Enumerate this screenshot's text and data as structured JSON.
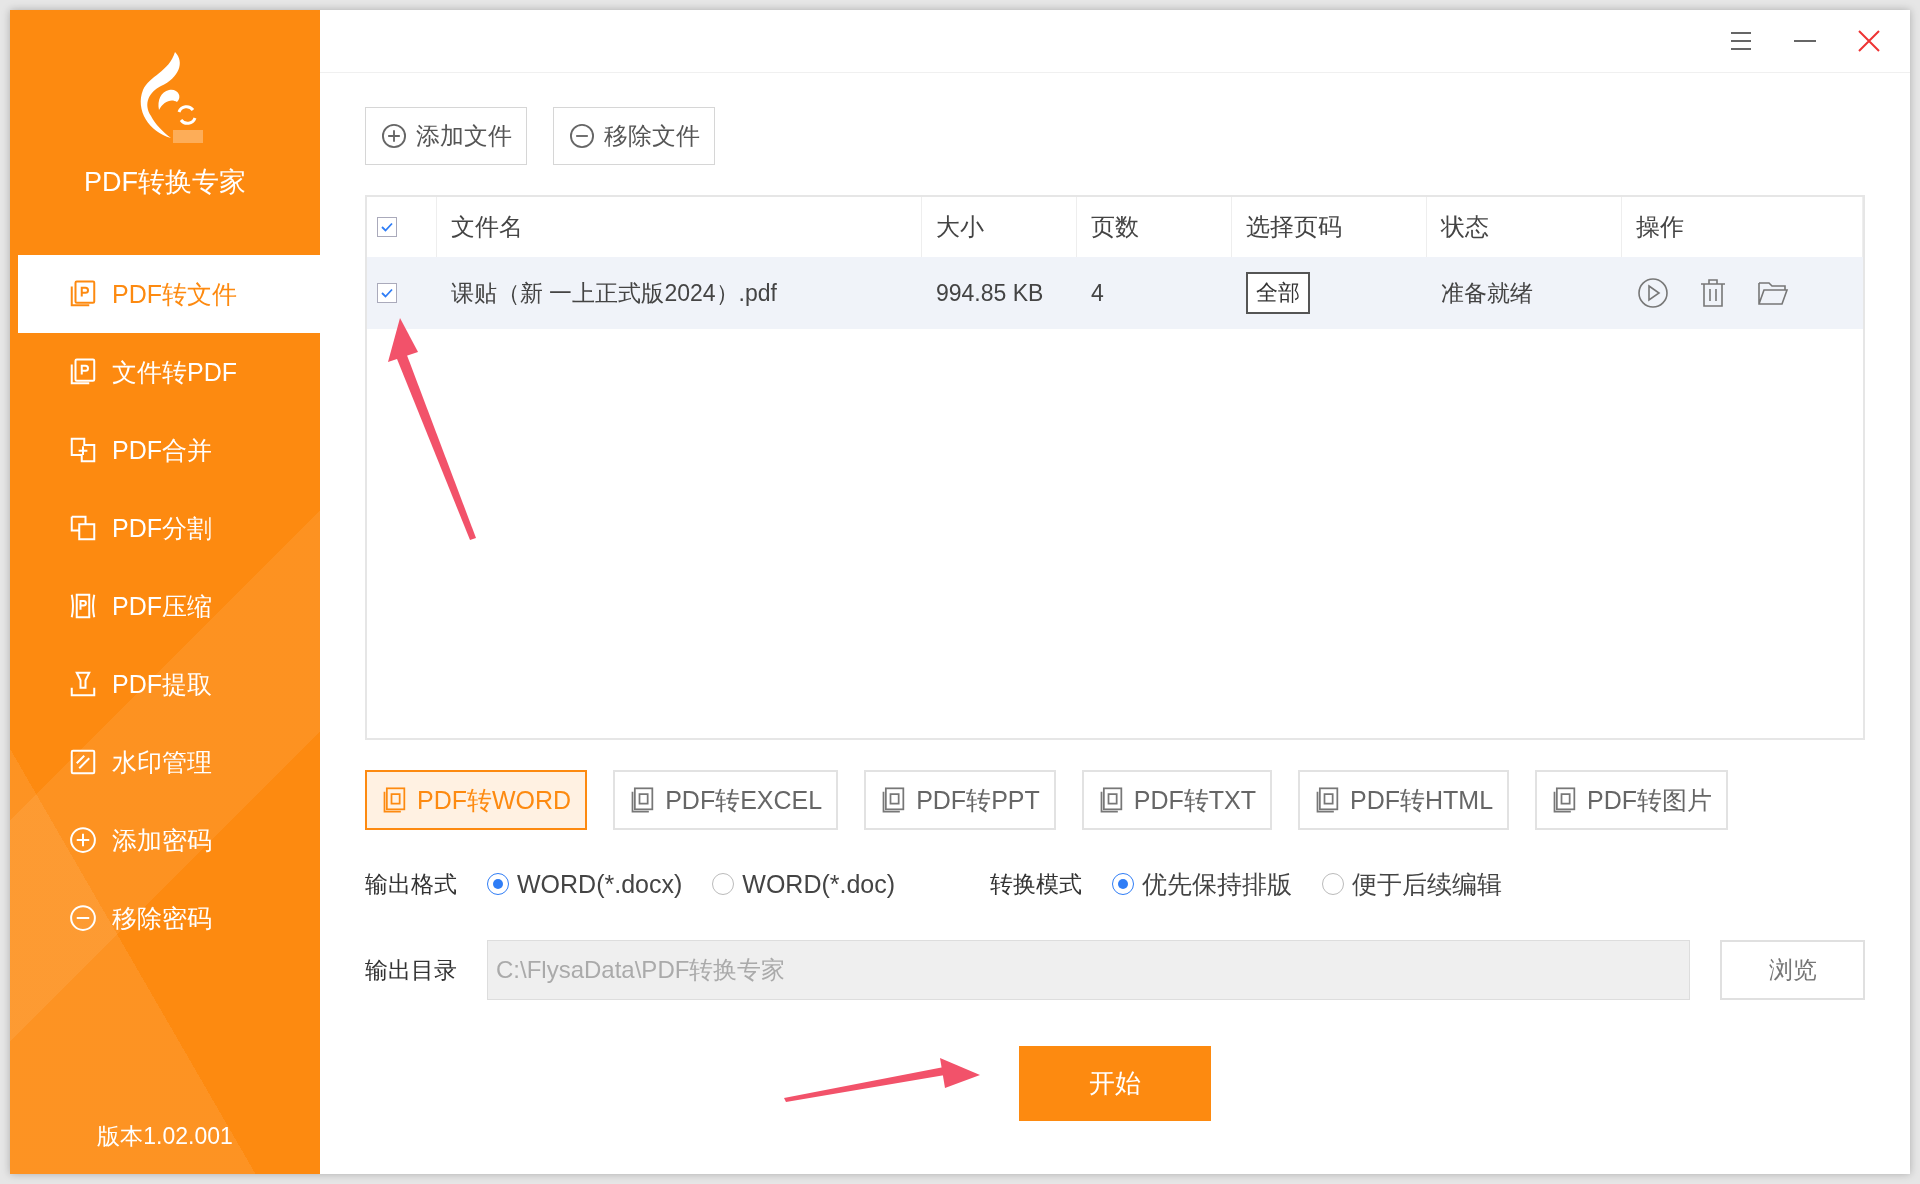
{
  "app": {
    "title": "PDF转换专家",
    "version": "版本1.02.001"
  },
  "sidebar": {
    "items": [
      {
        "label": "PDF转文件",
        "kind": "pdf-to-file",
        "selected": true
      },
      {
        "label": "文件转PDF",
        "kind": "file-to-pdf",
        "selected": false
      },
      {
        "label": "PDF合并",
        "kind": "merge",
        "selected": false
      },
      {
        "label": "PDF分割",
        "kind": "split",
        "selected": false
      },
      {
        "label": "PDF压缩",
        "kind": "compress",
        "selected": false
      },
      {
        "label": "PDF提取",
        "kind": "extract",
        "selected": false
      },
      {
        "label": "水印管理",
        "kind": "watermark",
        "selected": false
      },
      {
        "label": "添加密码",
        "kind": "add",
        "selected": false
      },
      {
        "label": "移除密码",
        "kind": "remove",
        "selected": false
      }
    ]
  },
  "toolbar": {
    "buttons": [
      {
        "label": "添加文件",
        "kind": "add"
      },
      {
        "label": "移除文件",
        "kind": "remove"
      }
    ]
  },
  "table": {
    "all_checked": true,
    "columns": [
      "文件名",
      "大小",
      "页数",
      "选择页码",
      "状态",
      "操作"
    ],
    "rows": [
      {
        "checked": true,
        "name": "课贴（新 一上正式版2024）.pdf",
        "size": "994.85 KB",
        "pages": "4",
        "page_range": "全部",
        "status": "准备就绪"
      }
    ]
  },
  "format_tabs": [
    {
      "label": "PDF转WORD",
      "selected": true
    },
    {
      "label": "PDF转EXCEL",
      "selected": false
    },
    {
      "label": "PDF转PPT",
      "selected": false
    },
    {
      "label": "PDF转TXT",
      "selected": false
    },
    {
      "label": "PDF转HTML",
      "selected": false
    },
    {
      "label": "PDF转图片",
      "selected": false
    }
  ],
  "output_format": {
    "label": "输出格式",
    "options": [
      {
        "label": "WORD(*.docx)",
        "selected": true
      },
      {
        "label": "WORD(*.doc)",
        "selected": false
      }
    ]
  },
  "convert_mode": {
    "label": "转换模式",
    "options": [
      {
        "label": "优先保持排版",
        "selected": true
      },
      {
        "label": "便于后续编辑",
        "selected": false
      }
    ]
  },
  "output_dir": {
    "label": "输出目录",
    "value": "C:\\FlysaData\\PDF转换专家",
    "disabled": true,
    "browse": "浏览"
  },
  "start_button": "开始"
}
